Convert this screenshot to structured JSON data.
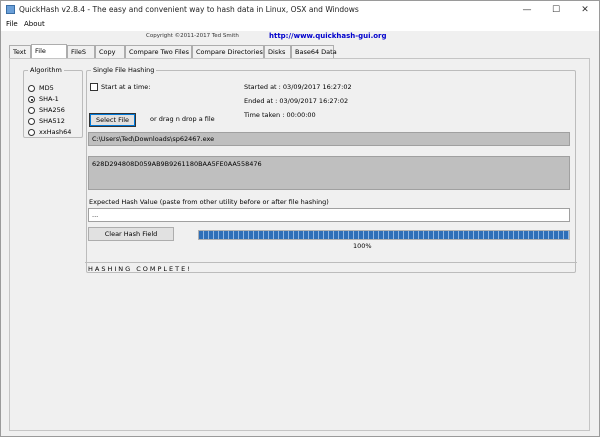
{
  "window": {
    "title": "QuickHash v2.8.4 - The easy and convenient way to hash data in Linux, OSX and Windows",
    "controls": {
      "minimize": "—",
      "maximize": "☐",
      "close": "✕"
    }
  },
  "menu": {
    "items": [
      "File",
      "About"
    ]
  },
  "header": {
    "copyright": "Copyright ©2011-2017 Ted Smith",
    "website": "http://www.quickhash-gui.org"
  },
  "tabs": [
    "Text",
    "File",
    "FileS",
    "Copy",
    "Compare Two Files",
    "Compare Directories",
    "Disks",
    "Base64 Data"
  ],
  "active_tab": "File",
  "algorithm": {
    "legend": "Algorithm",
    "options": [
      "MD5",
      "SHA-1",
      "SHA256",
      "SHA512",
      "xxHash64"
    ],
    "selected": "SHA-1"
  },
  "single_file": {
    "legend": "Single File Hashing",
    "start_at_label": "Start at a time:",
    "started_at": "Started at : 03/09/2017 16:27:02",
    "ended_at": "Ended at    : 03/09/2017 16:27:02",
    "time_taken": "Time taken : 00:00:00",
    "select_file_label": "Select File",
    "drag_text": "or drag n drop a file",
    "file_path": "C:\\Users\\Ted\\Downloads\\sp62467.exe",
    "hash_value": "628D294808D059AB9B9261180BAA5FE0AA558476",
    "expected_label": "Expected Hash Value (paste from other utility before or after file hashing)",
    "expected_value": "...",
    "clear_label": "Clear Hash Field",
    "progress_percent": 100,
    "progress_text": "100%",
    "status": "HASHING COMPLETE!"
  }
}
